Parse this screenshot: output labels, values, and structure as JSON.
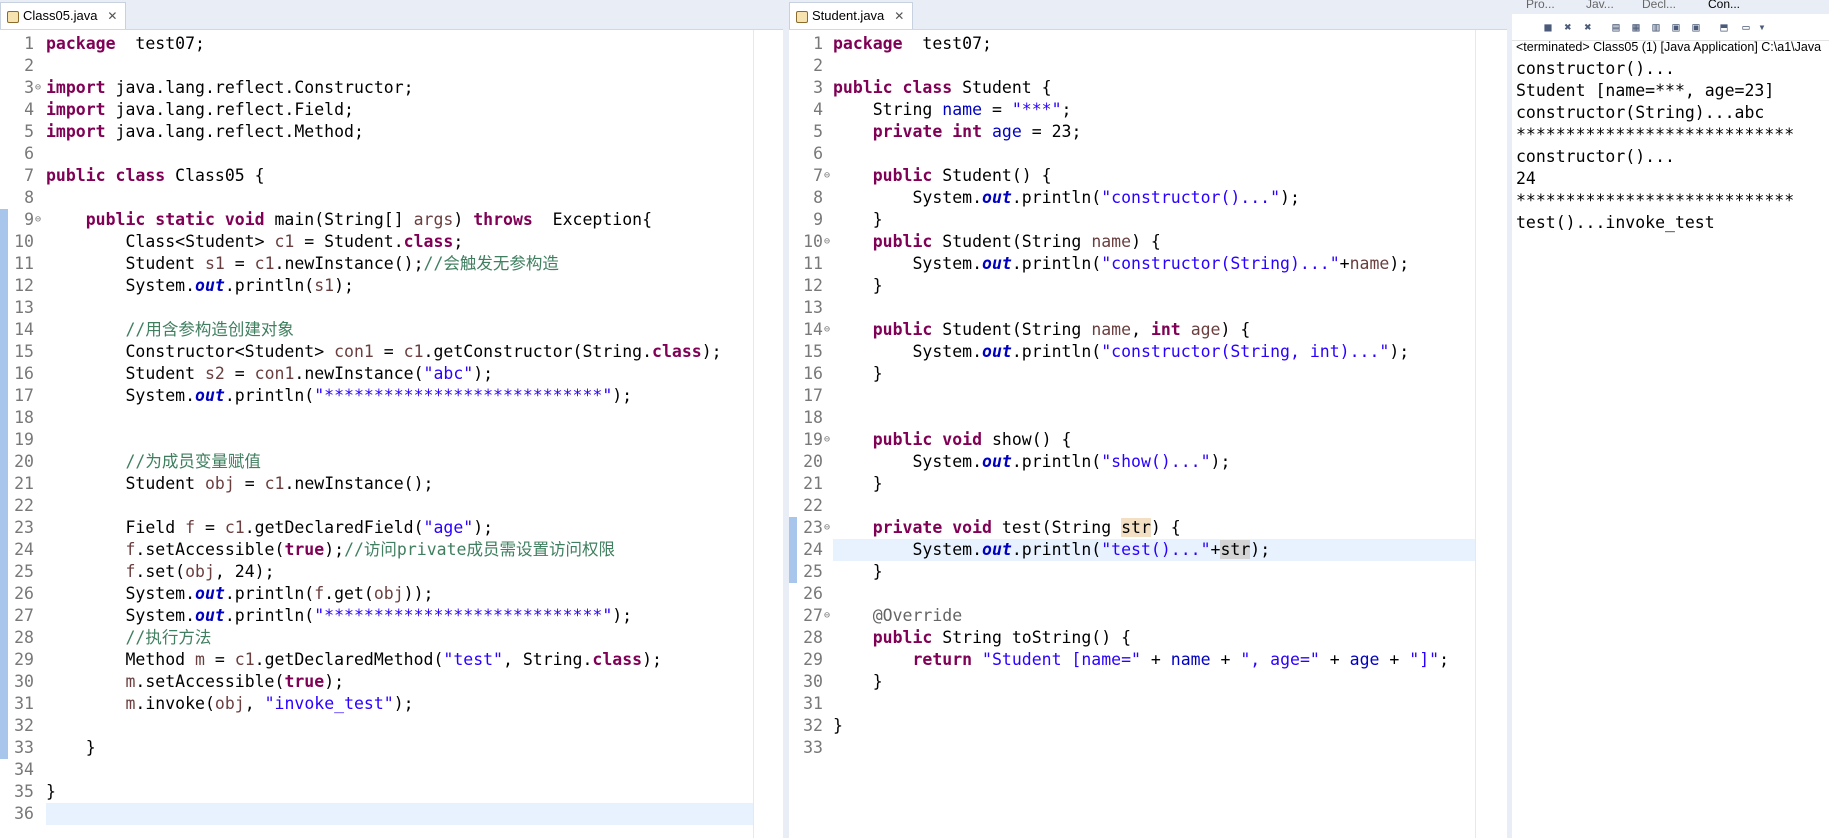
{
  "editor_left": {
    "tab_title": "Class05.java",
    "lines": [
      [
        [
          "kw",
          "package"
        ],
        [
          "",
          "  test07;"
        ]
      ],
      [],
      [
        [
          "kw",
          "import"
        ],
        [
          "",
          " java.lang.reflect.Constructor;"
        ]
      ],
      [
        [
          "kw",
          "import"
        ],
        [
          "",
          " java.lang.reflect.Field;"
        ]
      ],
      [
        [
          "kw",
          "import"
        ],
        [
          "",
          " java.lang.reflect.Method;"
        ]
      ],
      [],
      [
        [
          "kw",
          "public class"
        ],
        [
          "",
          " Class05 {"
        ]
      ],
      [],
      [
        [
          "",
          "    "
        ],
        [
          "kw",
          "public static void"
        ],
        [
          "",
          " main(String[] "
        ],
        [
          "var",
          "args"
        ],
        [
          "",
          ") "
        ],
        [
          "kw",
          "throws"
        ],
        [
          "",
          "  Exception{"
        ]
      ],
      [
        [
          "",
          "        Class<Student> "
        ],
        [
          "var",
          "c1"
        ],
        [
          "",
          " = Student."
        ],
        [
          "kw",
          "class"
        ],
        [
          "",
          ";"
        ]
      ],
      [
        [
          "",
          "        Student "
        ],
        [
          "var",
          "s1"
        ],
        [
          "",
          " = "
        ],
        [
          "var",
          "c1"
        ],
        [
          "",
          ".newInstance();"
        ],
        [
          "cm",
          "//会触发无参构造"
        ]
      ],
      [
        [
          "",
          "        System."
        ],
        [
          "sfld",
          "out"
        ],
        [
          "",
          ".println("
        ],
        [
          "var",
          "s1"
        ],
        [
          "",
          ");"
        ]
      ],
      [],
      [
        [
          "",
          "        "
        ],
        [
          "cm",
          "//用含参构造创建对象"
        ]
      ],
      [
        [
          "",
          "        Constructor<Student> "
        ],
        [
          "var",
          "con1"
        ],
        [
          "",
          " = "
        ],
        [
          "var",
          "c1"
        ],
        [
          "",
          ".getConstructor(String."
        ],
        [
          "kw",
          "class"
        ],
        [
          "",
          ");"
        ]
      ],
      [
        [
          "",
          "        Student "
        ],
        [
          "var",
          "s2"
        ],
        [
          "",
          " = "
        ],
        [
          "var",
          "con1"
        ],
        [
          "",
          ".newInstance("
        ],
        [
          "str",
          "\"abc\""
        ],
        [
          "",
          ");"
        ]
      ],
      [
        [
          "",
          "        System."
        ],
        [
          "sfld",
          "out"
        ],
        [
          "",
          ".println("
        ],
        [
          "str",
          "\"****************************\""
        ],
        [
          "",
          ");"
        ]
      ],
      [],
      [],
      [
        [
          "",
          "        "
        ],
        [
          "cm",
          "//为成员变量赋值"
        ]
      ],
      [
        [
          "",
          "        Student "
        ],
        [
          "var",
          "obj"
        ],
        [
          "",
          " = "
        ],
        [
          "var",
          "c1"
        ],
        [
          "",
          ".newInstance();"
        ]
      ],
      [],
      [
        [
          "",
          "        Field "
        ],
        [
          "var",
          "f"
        ],
        [
          "",
          " = "
        ],
        [
          "var",
          "c1"
        ],
        [
          "",
          ".getDeclaredField("
        ],
        [
          "str",
          "\"age\""
        ],
        [
          "",
          ");"
        ]
      ],
      [
        [
          "",
          "        "
        ],
        [
          "var",
          "f"
        ],
        [
          "",
          ".setAccessible("
        ],
        [
          "kw",
          "true"
        ],
        [
          "",
          ");"
        ],
        [
          "cm",
          "//访问private成员需设置访问权限"
        ]
      ],
      [
        [
          "",
          "        "
        ],
        [
          "var",
          "f"
        ],
        [
          "",
          ".set("
        ],
        [
          "var",
          "obj"
        ],
        [
          "",
          ", 24);"
        ]
      ],
      [
        [
          "",
          "        System."
        ],
        [
          "sfld",
          "out"
        ],
        [
          "",
          ".println("
        ],
        [
          "var",
          "f"
        ],
        [
          "",
          ".get("
        ],
        [
          "var",
          "obj"
        ],
        [
          "",
          "));"
        ]
      ],
      [
        [
          "",
          "        System."
        ],
        [
          "sfld",
          "out"
        ],
        [
          "",
          ".println("
        ],
        [
          "str",
          "\"****************************\""
        ],
        [
          "",
          ");"
        ]
      ],
      [
        [
          "",
          "        "
        ],
        [
          "cm",
          "//执行方法"
        ]
      ],
      [
        [
          "",
          "        Method "
        ],
        [
          "var",
          "m"
        ],
        [
          "",
          " = "
        ],
        [
          "var",
          "c1"
        ],
        [
          "",
          ".getDeclaredMethod("
        ],
        [
          "str",
          "\"test\""
        ],
        [
          "",
          ", String."
        ],
        [
          "kw",
          "class"
        ],
        [
          "",
          ");"
        ]
      ],
      [
        [
          "",
          "        "
        ],
        [
          "var",
          "m"
        ],
        [
          "",
          ".setAccessible("
        ],
        [
          "kw",
          "true"
        ],
        [
          "",
          ");"
        ]
      ],
      [
        [
          "",
          "        "
        ],
        [
          "var",
          "m"
        ],
        [
          "",
          ".invoke("
        ],
        [
          "var",
          "obj"
        ],
        [
          "",
          ", "
        ],
        [
          "str",
          "\"invoke_test\""
        ],
        [
          "",
          ");"
        ]
      ],
      [],
      [
        [
          "",
          "    }"
        ]
      ],
      [],
      [
        [
          "",
          "}"
        ]
      ],
      []
    ]
  },
  "editor_right": {
    "tab_title": "Student.java",
    "lines": [
      [
        [
          "kw",
          "package"
        ],
        [
          "",
          "  test07;"
        ]
      ],
      [],
      [
        [
          "kw",
          "public class"
        ],
        [
          "",
          " Student {"
        ]
      ],
      [
        [
          "",
          "    String "
        ],
        [
          "fld",
          "name"
        ],
        [
          "",
          " = "
        ],
        [
          "str",
          "\"***\""
        ],
        [
          "",
          ";"
        ]
      ],
      [
        [
          "",
          "    "
        ],
        [
          "kw",
          "private int"
        ],
        [
          "",
          " "
        ],
        [
          "fld",
          "age"
        ],
        [
          "",
          " = 23;"
        ]
      ],
      [],
      [
        [
          "",
          "    "
        ],
        [
          "kw",
          "public"
        ],
        [
          "",
          " Student() {"
        ]
      ],
      [
        [
          "",
          "        System."
        ],
        [
          "sfld",
          "out"
        ],
        [
          "",
          ".println("
        ],
        [
          "str",
          "\"constructor()...\""
        ],
        [
          "",
          ");"
        ]
      ],
      [
        [
          "",
          "    }"
        ]
      ],
      [
        [
          "",
          "    "
        ],
        [
          "kw",
          "public"
        ],
        [
          "",
          " Student(String "
        ],
        [
          "var",
          "name"
        ],
        [
          "",
          ") {"
        ]
      ],
      [
        [
          "",
          "        System."
        ],
        [
          "sfld",
          "out"
        ],
        [
          "",
          ".println("
        ],
        [
          "str",
          "\"constructor(String)...\""
        ],
        [
          "",
          "+"
        ],
        [
          "var",
          "name"
        ],
        [
          "",
          ");"
        ]
      ],
      [
        [
          "",
          "    }"
        ]
      ],
      [],
      [
        [
          "",
          "    "
        ],
        [
          "kw",
          "public"
        ],
        [
          "",
          " Student(String "
        ],
        [
          "var",
          "name"
        ],
        [
          "",
          ", "
        ],
        [
          "kw",
          "int"
        ],
        [
          "",
          " "
        ],
        [
          "var",
          "age"
        ],
        [
          "",
          ") {"
        ]
      ],
      [
        [
          "",
          "        System."
        ],
        [
          "sfld",
          "out"
        ],
        [
          "",
          ".println("
        ],
        [
          "str",
          "\"constructor(String, int)...\""
        ],
        [
          "",
          ");"
        ]
      ],
      [
        [
          "",
          "    }"
        ]
      ],
      [],
      [],
      [
        [
          "",
          "    "
        ],
        [
          "kw",
          "public void"
        ],
        [
          "",
          " show() {"
        ]
      ],
      [
        [
          "",
          "        System."
        ],
        [
          "sfld",
          "out"
        ],
        [
          "",
          ".println("
        ],
        [
          "str",
          "\"show()...\""
        ],
        [
          "",
          ");"
        ]
      ],
      [
        [
          "",
          "    }"
        ]
      ],
      [],
      [
        [
          "",
          "    "
        ],
        [
          "kw",
          "private void"
        ],
        [
          "",
          " test(String "
        ],
        [
          "hl",
          "str"
        ],
        [
          "",
          ") {"
        ]
      ],
      [
        [
          "",
          "        System."
        ],
        [
          "sfld",
          "out"
        ],
        [
          "",
          ".println("
        ],
        [
          "str",
          "\"test()...\""
        ],
        [
          "",
          "+"
        ],
        [
          "hl2",
          "str"
        ],
        [
          "",
          ");"
        ]
      ],
      [
        [
          "",
          "    }"
        ]
      ],
      [],
      [
        [
          "",
          "    "
        ],
        [
          "ann",
          "@Override"
        ]
      ],
      [
        [
          "",
          "    "
        ],
        [
          "kw",
          "public"
        ],
        [
          "",
          " String toString() {"
        ]
      ],
      [
        [
          "",
          "        "
        ],
        [
          "kw",
          "return"
        ],
        [
          "",
          " "
        ],
        [
          "str",
          "\"Student [name=\""
        ],
        [
          "",
          " + "
        ],
        [
          "fld",
          "name"
        ],
        [
          "",
          " + "
        ],
        [
          "str",
          "\", age=\""
        ],
        [
          "",
          " + "
        ],
        [
          "fld",
          "age"
        ],
        [
          "",
          " + "
        ],
        [
          "str",
          "\"]\""
        ],
        [
          "",
          ";"
        ]
      ],
      [
        [
          "",
          "    }"
        ]
      ],
      [],
      [
        [
          "",
          "}"
        ]
      ],
      []
    ]
  },
  "console": {
    "tabs": [
      "Pro...",
      "Jav...",
      "Decl...",
      "Con..."
    ],
    "status": "<terminated> Class05 (1) [Java Application] C:\\a1\\Java",
    "output": [
      "constructor()...",
      "Student [name=***, age=23]",
      "constructor(String)...abc",
      "****************************",
      "constructor()...",
      "24",
      "****************************",
      "test()...invoke_test"
    ]
  }
}
